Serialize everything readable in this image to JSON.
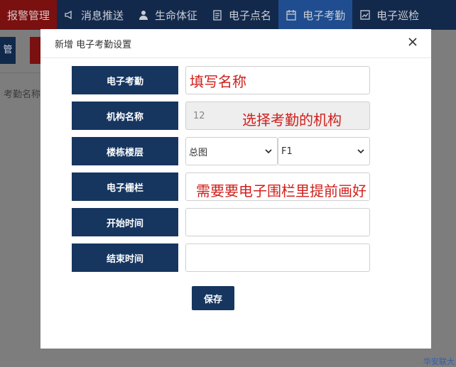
{
  "nav": {
    "items": [
      {
        "label": "报警管理",
        "icon": "bell-icon",
        "state": "red"
      },
      {
        "label": "消息推送",
        "icon": "megaphone-icon",
        "state": "normal"
      },
      {
        "label": "生命体征",
        "icon": "person-icon",
        "state": "normal"
      },
      {
        "label": "电子点名",
        "icon": "clipboard-icon",
        "state": "normal"
      },
      {
        "label": "电子考勤",
        "icon": "calendar-icon",
        "state": "active"
      },
      {
        "label": "电子巡检",
        "icon": "chart-icon",
        "state": "normal"
      }
    ]
  },
  "background": {
    "button_text": "管",
    "filter_label": "考勤名称",
    "brand": "华安联大"
  },
  "modal": {
    "title": "新增 电子考勤设置",
    "close_icon": "close-icon",
    "fields": {
      "name": {
        "label": "电子考勤",
        "value": "",
        "annotation": "填写名称"
      },
      "org": {
        "label": "机构名称",
        "value": "12",
        "annotation": "选择考勤的机构"
      },
      "floor": {
        "label": "楼栋楼层",
        "building_value": "总图",
        "floor_value": "F1"
      },
      "fence": {
        "label": "电子栅栏",
        "value": "",
        "annotation": "需要要电子围栏里提前画好"
      },
      "start": {
        "label": "开始时间",
        "value": ""
      },
      "end": {
        "label": "结束时间",
        "value": ""
      }
    },
    "save_label": "保存"
  },
  "colors": {
    "nav_bg": "#13294b",
    "label_bg": "#163660",
    "annotation": "#d0201c",
    "active_tab": "#1f4d8f",
    "alarm_tab": "#7a1010"
  }
}
